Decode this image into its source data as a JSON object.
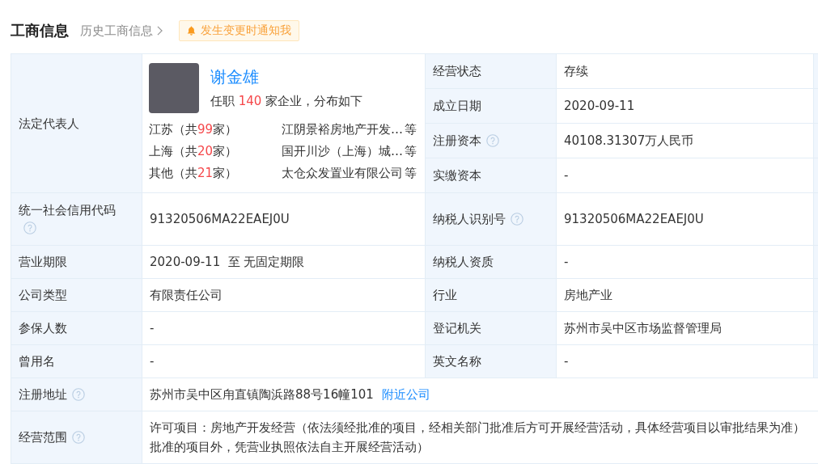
{
  "header": {
    "title": "工商信息",
    "history_link": "历史工商信息",
    "notify_button": "发生变更时通知我"
  },
  "legal_representative": {
    "label": "法定代表人",
    "name": "谢金雄",
    "summary": {
      "before": "任职 ",
      "count": "140",
      "after": " 家企业，分布如下"
    },
    "regions": [
      {
        "before": "江苏（共",
        "count": "99",
        "after": "家）",
        "company": "江阴景裕房地产开发…",
        "more": "等"
      },
      {
        "before": "上海（共",
        "count": "20",
        "after": "家）",
        "company": "国开川沙（上海）城…",
        "more": "等"
      },
      {
        "before": "其他（共",
        "count": "21",
        "after": "家）",
        "company": "太仓众发置业有限公司",
        "more": "等"
      }
    ]
  },
  "status_fields": [
    {
      "label": "经营状态",
      "help": false,
      "value": "存续"
    },
    {
      "label": "成立日期",
      "help": false,
      "value": "2020-09-11"
    },
    {
      "label": "注册资本",
      "help": true,
      "value": "40108.31307万人民币"
    },
    {
      "label": "实缴资本",
      "help": false,
      "value": "-"
    }
  ],
  "field_rows": [
    [
      {
        "label": "统一社会信用代码",
        "help": true,
        "value": "91320506MA22EAEJ0U"
      },
      {
        "label": "纳税人识别号",
        "help": true,
        "value": "91320506MA22EAEJ0U"
      }
    ],
    [
      {
        "label": "营业期限",
        "help": false,
        "value": "2020-09-11  至 无固定期限"
      },
      {
        "label": "纳税人资质",
        "help": false,
        "value": "-"
      }
    ],
    [
      {
        "label": "公司类型",
        "help": false,
        "value": "有限责任公司"
      },
      {
        "label": "行业",
        "help": false,
        "value": "房地产业"
      }
    ],
    [
      {
        "label": "参保人数",
        "help": false,
        "value": "-"
      },
      {
        "label": "登记机关",
        "help": false,
        "value": "苏州市吴中区市场监督管理局"
      }
    ],
    [
      {
        "label": "曾用名",
        "help": false,
        "value": "-"
      },
      {
        "label": "英文名称",
        "help": false,
        "value": "-"
      }
    ]
  ],
  "address": {
    "label": "注册地址",
    "help": true,
    "value": "苏州市吴中区甪直镇陶浜路88号16幢101",
    "link": "附近公司"
  },
  "business_scope": {
    "label": "经营范围",
    "help": true,
    "lines": [
      "许可项目：房地产开发经营（依法须经批准的项目，经相关部门批准后方可开展经营活动，具体经营项目以审批结果为准）",
      "批准的项目外，凭营业执照依法自主开展经营活动）"
    ]
  }
}
